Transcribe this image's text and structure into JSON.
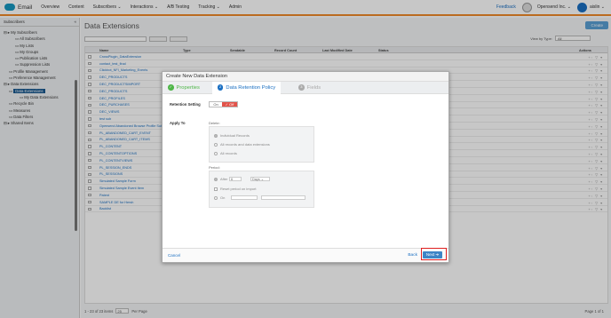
{
  "nav": {
    "app": "Email",
    "items": [
      "Overview",
      "Content",
      "Subscribers",
      "Interactions",
      "A/B Testing",
      "Tracking",
      "Admin"
    ],
    "feedback": "Feedback",
    "org": "Opensend Inc.",
    "user": "aislin"
  },
  "sidebar": {
    "title": "Subscribers",
    "tree": [
      {
        "label": "My Subscribers",
        "level": 1
      },
      {
        "label": "All Subscribers",
        "level": 3
      },
      {
        "label": "My Lists",
        "level": 3
      },
      {
        "label": "My Groups",
        "level": 3
      },
      {
        "label": "Publication Lists",
        "level": 3
      },
      {
        "label": "Suppression Lists",
        "level": 3
      },
      {
        "label": "Profile Management",
        "level": 2
      },
      {
        "label": "Preference Management",
        "level": 2
      },
      {
        "label": "Data Extensions",
        "level": 1
      },
      {
        "label": "Data Extensions",
        "level": 2,
        "selected": true
      },
      {
        "label": "My Data Extensions",
        "level": 4
      },
      {
        "label": "Recycle Bin",
        "level": 2
      },
      {
        "label": "Measures",
        "level": 2
      },
      {
        "label": "Data Filters",
        "level": 2
      },
      {
        "label": "Shared Items",
        "level": 1
      }
    ]
  },
  "main": {
    "title": "Data Extensions",
    "create_label": "Create",
    "view_type_label": "View by Type:",
    "view_type_value": "All",
    "columns": [
      "Name",
      "Type",
      "Sendable",
      "Record Count",
      "Last Modified Date",
      "Status",
      "Actions"
    ],
    "rows": [
      "CrossPlugin_DataExtension",
      "contact_test_final",
      "Clickbot_NFI_Marketing_Events",
      "DEC_PRODUCTS",
      "DEC_PRODUCTSIMPORT",
      "DEC_PRODUCTS",
      "DEC_PROFILES",
      "DEC_PURCHASES",
      "DEC_VIEWS",
      "test sub",
      "Opensend Abandoned Browse Profile Sub",
      "PL_ABANDONED_CART_EVENT",
      "PL_ABANDONED_CART_ITEMS",
      "PL_CONTENT",
      "PL_CONTENTOPTIONS",
      "PL_CONTENTVIEWS",
      "PL_SESSION_ENDS",
      "PL_SESSIONS",
      "Simulated Sample Form",
      "Simulated Sample Event Item",
      "Patent",
      "SAMPLE DE for Hersh",
      "Backlist"
    ],
    "footer_items": "1 - 23 of 23 items",
    "per_page": "25",
    "per_page_label": "Per Page",
    "page_label": "Page",
    "page_value": "1",
    "page_of": "of 1"
  },
  "modal": {
    "title": "Create New Data Extension",
    "steps": [
      {
        "label": "Properties",
        "state": "done",
        "num": "✓"
      },
      {
        "label": "Data Retention Policy",
        "state": "active",
        "num": "2"
      },
      {
        "label": "Fields",
        "state": "todo",
        "num": "3"
      }
    ],
    "retention_label": "Retention Setting",
    "toggle_on": "On",
    "toggle_off": "Off",
    "apply_to_label": "Apply To",
    "delete_label": "Delete:",
    "delete_options": [
      "Individual Records",
      "All records and data extensions",
      "All records"
    ],
    "period_label": "Period:",
    "after_label": "After",
    "after_value": "6",
    "unit_value": "Days",
    "reset_label": "Reset period on import",
    "on_label": "On",
    "cancel": "Cancel",
    "back": "Back",
    "next": "Next"
  }
}
